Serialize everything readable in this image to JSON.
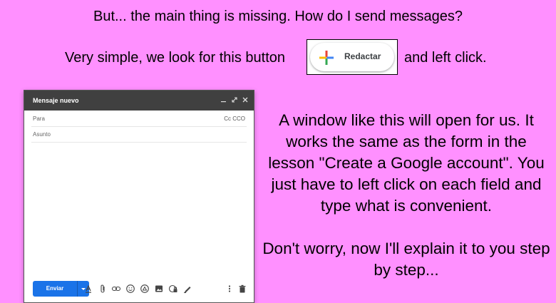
{
  "heading": "But... the main thing is missing. How do I send messages?",
  "intro": {
    "left": "Very simple, we look for this button",
    "right": "and left click."
  },
  "compose_button": {
    "label": "Redactar",
    "icon": "colored-plus-icon"
  },
  "compose_window": {
    "title": "Mensaje nuevo",
    "controls": [
      "minimize-icon",
      "expand-icon",
      "close-icon"
    ],
    "to_placeholder": "Para",
    "cc_bcc": "Cc CCO",
    "subject_placeholder": "Asunto",
    "send_label": "Enviar",
    "toolbar_icons": [
      "format-text-icon",
      "attach-icon",
      "link-icon",
      "emoji-icon",
      "drive-icon",
      "photo-icon",
      "confidential-icon",
      "signature-icon",
      "more-options-icon",
      "trash-icon"
    ]
  },
  "explanation": {
    "paragraph1": "A window like this will open for us. It works the same as the form in the lesson \"Create a Google account\". You just have to left click on each field and type what is convenient.",
    "paragraph2": "Don't worry, now I'll explain it to you step by step..."
  },
  "colors": {
    "background": "#ff90ff",
    "send_blue": "#1a73e8",
    "header_dark": "#404040"
  }
}
